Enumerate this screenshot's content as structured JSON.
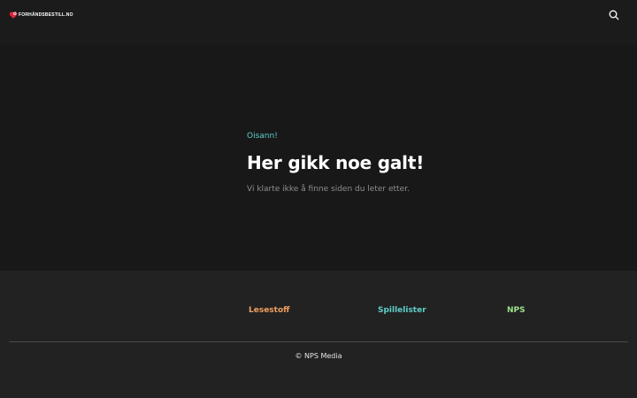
{
  "header": {
    "logo_text": "FORHÅNDSBESTILL.NO",
    "logo_color": "#e0233a",
    "search_icon": "search-icon"
  },
  "error": {
    "kicker": "Oisann!",
    "title": "Her gikk noe galt!",
    "description": "Vi klarte ikke å finne siden du leter etter."
  },
  "footer": {
    "links": [
      {
        "label": "Lesestoff",
        "color": "#f0a060"
      },
      {
        "label": "Spillelister",
        "color": "#5fcfc8"
      },
      {
        "label": "NPS",
        "color": "#9fe08a"
      }
    ],
    "copyright": "© NPS Media"
  }
}
